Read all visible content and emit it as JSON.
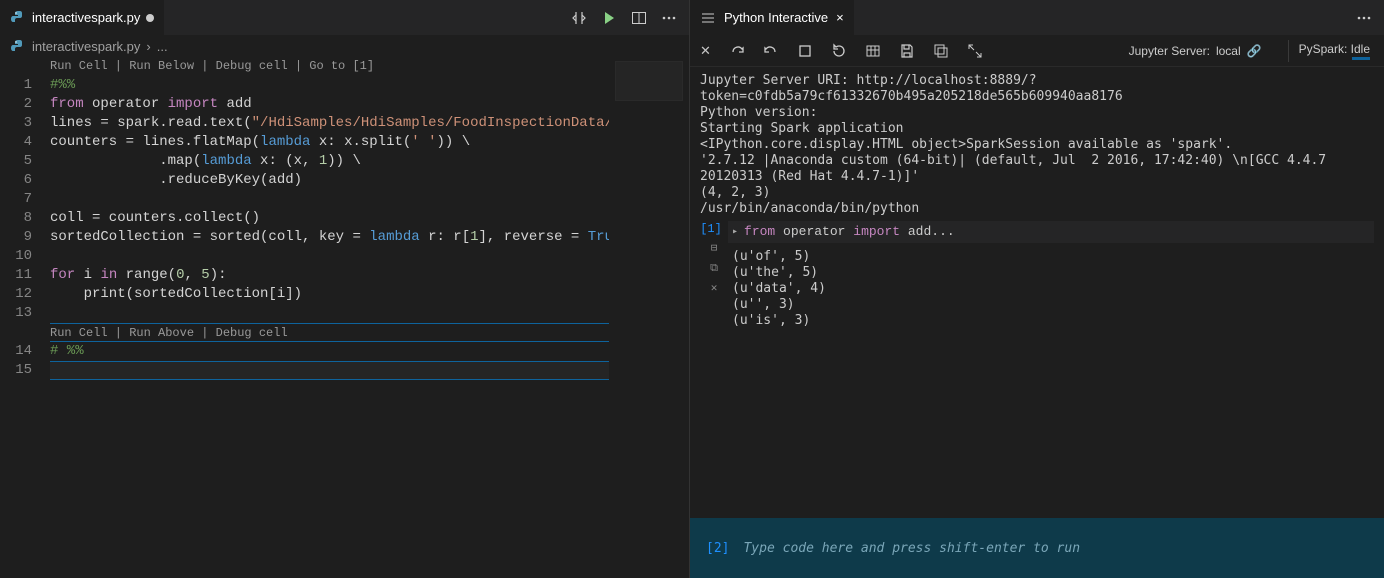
{
  "editor": {
    "tab": {
      "filename": "interactivespark.py",
      "dirty": true
    },
    "breadcrumb": {
      "filename": "interactivespark.py",
      "rest": "..."
    },
    "lens1": "Run Cell | Run Below | Debug cell | Go to [1]",
    "lens2": "Run Cell | Run Above | Debug cell",
    "lines": {
      "1": "#%%",
      "2a": "from",
      "2b": " operator ",
      "2c": "import",
      "2d": " add",
      "3a": "lines = spark.read.text(",
      "3b": "\"/HdiSamples/HdiSamples/FoodInspectionData/RE",
      "4a": "counters = lines.flatMap(",
      "4b": "lambda",
      "4c": " x: x.split(",
      "4d": "' '",
      "4e": ")) \\",
      "5a": "             .map(",
      "5b": "lambda",
      "5c": " x: (x, ",
      "5d": "1",
      "5e": ")) \\",
      "6": "             .reduceByKey(add)",
      "8": "coll = counters.collect()",
      "9a": "sortedCollection = sorted(coll, key = ",
      "9b": "lambda",
      "9c": " r: r[",
      "9d": "1",
      "9e": "], reverse = ",
      "9f": "True",
      "9g": ")",
      "11a": "for",
      "11b": " i ",
      "11c": "in",
      "11d": " range(",
      "11e": "0",
      "11f": ", ",
      "11g": "5",
      "11h": "):",
      "12a": "    print(sortedCollection[i])",
      "14": "# %%"
    },
    "line_numbers": [
      "1",
      "2",
      "3",
      "4",
      "5",
      "6",
      "7",
      "8",
      "9",
      "10",
      "11",
      "12",
      "13",
      "14",
      "15"
    ]
  },
  "interactive": {
    "tab_title": "Python Interactive",
    "status": {
      "jupyter_label": "Jupyter Server: ",
      "jupyter_value": "local",
      "pyspark_label": "PySpark: ",
      "pyspark_value": "Idle"
    },
    "header_output": "Jupyter Server URI: http://localhost:8889/?token=c0fdb5a79cf61332670b495a205218de565b609940aa8176\nPython version:\nStarting Spark application\n<IPython.core.display.HTML object>SparkSession available as 'spark'.\n'2.7.12 |Anaconda custom (64-bit)| (default, Jul  2 2016, 17:42:40) \\n[GCC 4.4.7 20120313 (Red Hat 4.4.7-1)]'\n(4, 2, 3)\n/usr/bin/anaconda/bin/python",
    "cell1": {
      "label": "[1]",
      "code_a": "from",
      "code_b": " operator ",
      "code_c": "import",
      "code_d": " add...",
      "output": "(u'of', 5)\n(u'the', 5)\n(u'data', 4)\n(u'', 3)\n(u'is', 3)"
    },
    "repl": {
      "prompt": "[2]",
      "placeholder": "Type code here and press shift-enter to run"
    }
  }
}
